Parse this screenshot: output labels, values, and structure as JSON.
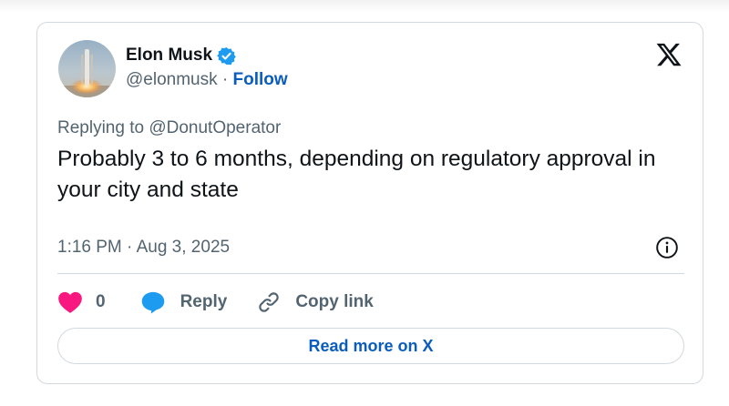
{
  "author": {
    "name": "Elon Musk",
    "handle": "@elonmusk",
    "separator": "·",
    "follow_label": "Follow",
    "verified_icon": "verified-badge-icon"
  },
  "platform_icon": "x-logo-icon",
  "tweet": {
    "replying_prefix": "Replying to",
    "replying_to": "@DonutOperator",
    "text": "Probably 3 to 6 months, depending on regulatory approval in your city and state",
    "timestamp": "1:16 PM · Aug 3, 2025"
  },
  "actions": {
    "like_count": "0",
    "reply_label": "Reply",
    "copy_link_label": "Copy link"
  },
  "read_more_label": "Read more on X",
  "colors": {
    "link_blue": "#0b5dbd",
    "verified_blue": "#1d9bf0",
    "like_pink": "#f91880",
    "text_primary": "#0f1419",
    "text_secondary": "#536471",
    "border": "#d4d9dd"
  }
}
